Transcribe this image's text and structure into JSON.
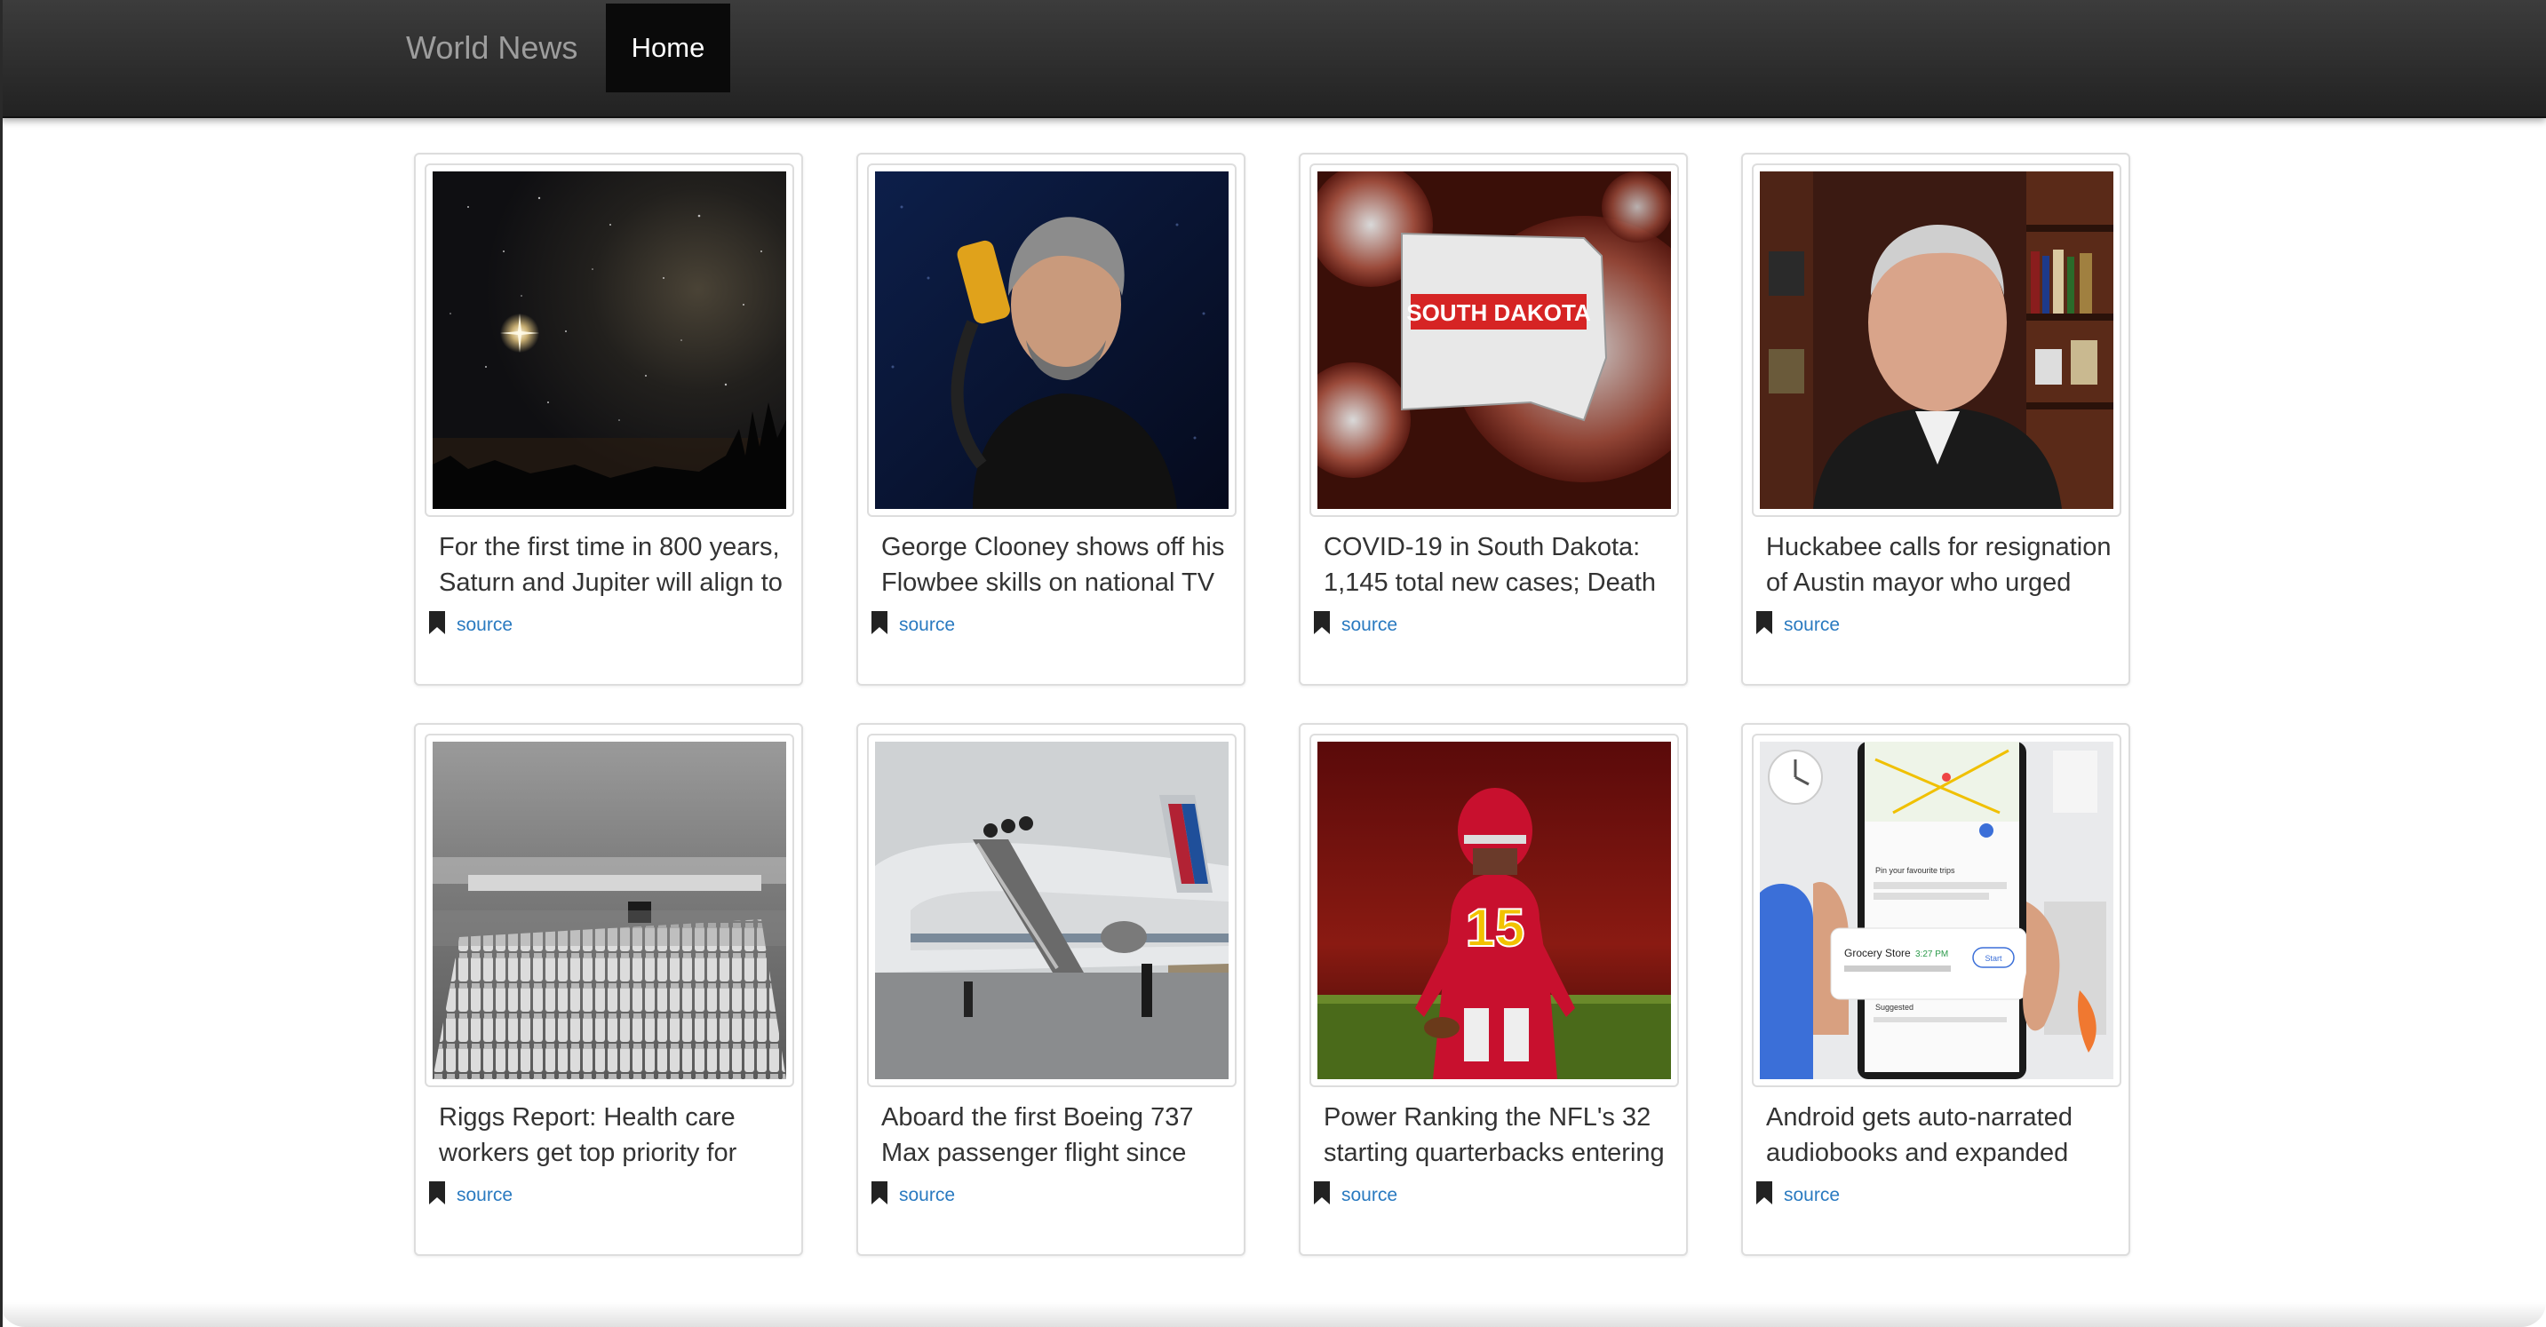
{
  "navbar": {
    "brand": "World News",
    "home_label": "Home"
  },
  "colors": {
    "navbar": "#2b2b2b",
    "active_tab": "#0a0a0a",
    "link": "#2a7ac0",
    "card_border": "#dddddd"
  },
  "articles": [
    {
      "headline": "For the first time in 800 years, Saturn and Jupiter will align to",
      "source_label": "source",
      "image": "night-sky-milky-way-photo"
    },
    {
      "headline": "George Clooney shows off his Flowbee skills on national TV -",
      "source_label": "source",
      "image": "george-clooney-with-flowbee-photo"
    },
    {
      "headline": "COVID-19 in South Dakota: 1,145 total new cases; Death",
      "source_label": "source",
      "image": "south-dakota-covid-map-graphic",
      "image_text": "SOUTH DAKOTA"
    },
    {
      "headline": "Huckabee calls for resignation of Austin mayor who urged",
      "source_label": "source",
      "image": "mike-huckabee-interview-photo"
    },
    {
      "headline": "Riggs Report: Health care workers get top priority for",
      "source_label": "source",
      "image": "vaccine-vials-production-line-photo"
    },
    {
      "headline": "Aboard the first Boeing 737 Max passenger flight since",
      "source_label": "source",
      "image": "american-airlines-boeing-737-boarding-photo"
    },
    {
      "headline": "Power Ranking the NFL's 32 starting quarterbacks entering",
      "source_label": "source",
      "image": "chiefs-quarterback-number-15-photo"
    },
    {
      "headline": "Android gets auto-narrated audiobooks and expanded",
      "source_label": "source",
      "image": "google-maps-phone-illustration",
      "image_text": {
        "trips_title": "Pin your favourite trips",
        "destination": "Grocery Store",
        "eta": "3:27 PM",
        "start": "Start",
        "suggested": "Suggested"
      }
    }
  ]
}
